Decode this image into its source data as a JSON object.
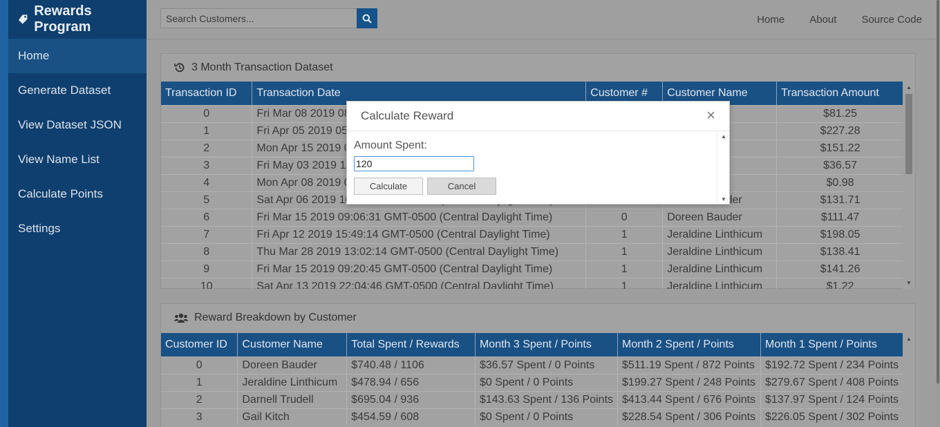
{
  "app": {
    "brand": "Rewards Program"
  },
  "sidebar": {
    "items": [
      {
        "label": "Home"
      },
      {
        "label": "Generate Dataset"
      },
      {
        "label": "View Dataset JSON"
      },
      {
        "label": "View Name List"
      },
      {
        "label": "Calculate Points"
      },
      {
        "label": "Settings"
      }
    ]
  },
  "search": {
    "placeholder": "Search Customers..."
  },
  "topnav": {
    "home": "Home",
    "about": "About",
    "source": "Source Code"
  },
  "transactions": {
    "title": "3 Month Transaction Dataset",
    "headers": [
      "Transaction ID",
      "Transaction Date",
      "Customer #",
      "Customer Name",
      "Transaction Amount"
    ],
    "rows": [
      [
        "0",
        "Fri Mar 08 2019 08",
        "",
        "Bauder",
        "$81.25"
      ],
      [
        "1",
        "Fri Apr 05 2019 05",
        "",
        "Bauder",
        "$227.28"
      ],
      [
        "2",
        "Mon Apr 15 2019 0",
        "",
        "Bauder",
        "$151.22"
      ],
      [
        "3",
        "Fri May 03 2019 11",
        "",
        "Bauder",
        "$36.57"
      ],
      [
        "4",
        "Mon Apr 08 2019 0",
        "",
        "Bauder",
        "$0.98"
      ],
      [
        "5",
        "Sat Apr 06 2019 10:22:09 GMT-0500 (Central Daylight Time)",
        "0",
        "Doreen Bauder",
        "$131.71"
      ],
      [
        "6",
        "Fri Mar 15 2019 09:06:31 GMT-0500 (Central Daylight Time)",
        "0",
        "Doreen Bauder",
        "$111.47"
      ],
      [
        "7",
        "Fri Apr 12 2019 15:49:14 GMT-0500 (Central Daylight Time)",
        "1",
        "Jeraldine Linthicum",
        "$198.05"
      ],
      [
        "8",
        "Thu Mar 28 2019 13:02:14 GMT-0500 (Central Daylight Time)",
        "1",
        "Jeraldine Linthicum",
        "$138.41"
      ],
      [
        "9",
        "Fri Mar 15 2019 09:20:45 GMT-0500 (Central Daylight Time)",
        "1",
        "Jeraldine Linthicum",
        "$141.26"
      ],
      [
        "10",
        "Sat Apr 13 2019 22:04:46 GMT-0500 (Central Daylight Time)",
        "1",
        "Jeraldine Linthicum",
        "$1.22"
      ]
    ]
  },
  "rewards": {
    "title": "Reward Breakdown by Customer",
    "headers": [
      "Customer ID",
      "Customer Name",
      "Total Spent / Rewards",
      "Month 3 Spent / Points",
      "Month 2 Spent / Points",
      "Month 1 Spent / Points"
    ],
    "rows": [
      [
        "0",
        "Doreen Bauder",
        "$740.48 / 1106",
        "$36.57 Spent / 0 Points",
        "$511.19 Spent / 872 Points",
        "$192.72 Spent / 234 Points"
      ],
      [
        "1",
        "Jeraldine Linthicum",
        "$478.94 / 656",
        "$0 Spent / 0 Points",
        "$199.27 Spent / 248 Points",
        "$279.67 Spent / 408 Points"
      ],
      [
        "2",
        "Darnell Trudell",
        "$695.04 / 936",
        "$143.63 Spent / 136 Points",
        "$413.44 Spent / 676 Points",
        "$137.97 Spent / 124 Points"
      ],
      [
        "3",
        "Gail Kitch",
        "$454.59 / 608",
        "$0 Spent / 0 Points",
        "$228.54 Spent / 306 Points",
        "$226.05 Spent / 302 Points"
      ]
    ]
  },
  "modal": {
    "title": "Calculate Reward",
    "close": "×",
    "label": "Amount Spent:",
    "value": "120",
    "calculate": "Calculate",
    "cancel": "Cancel"
  }
}
